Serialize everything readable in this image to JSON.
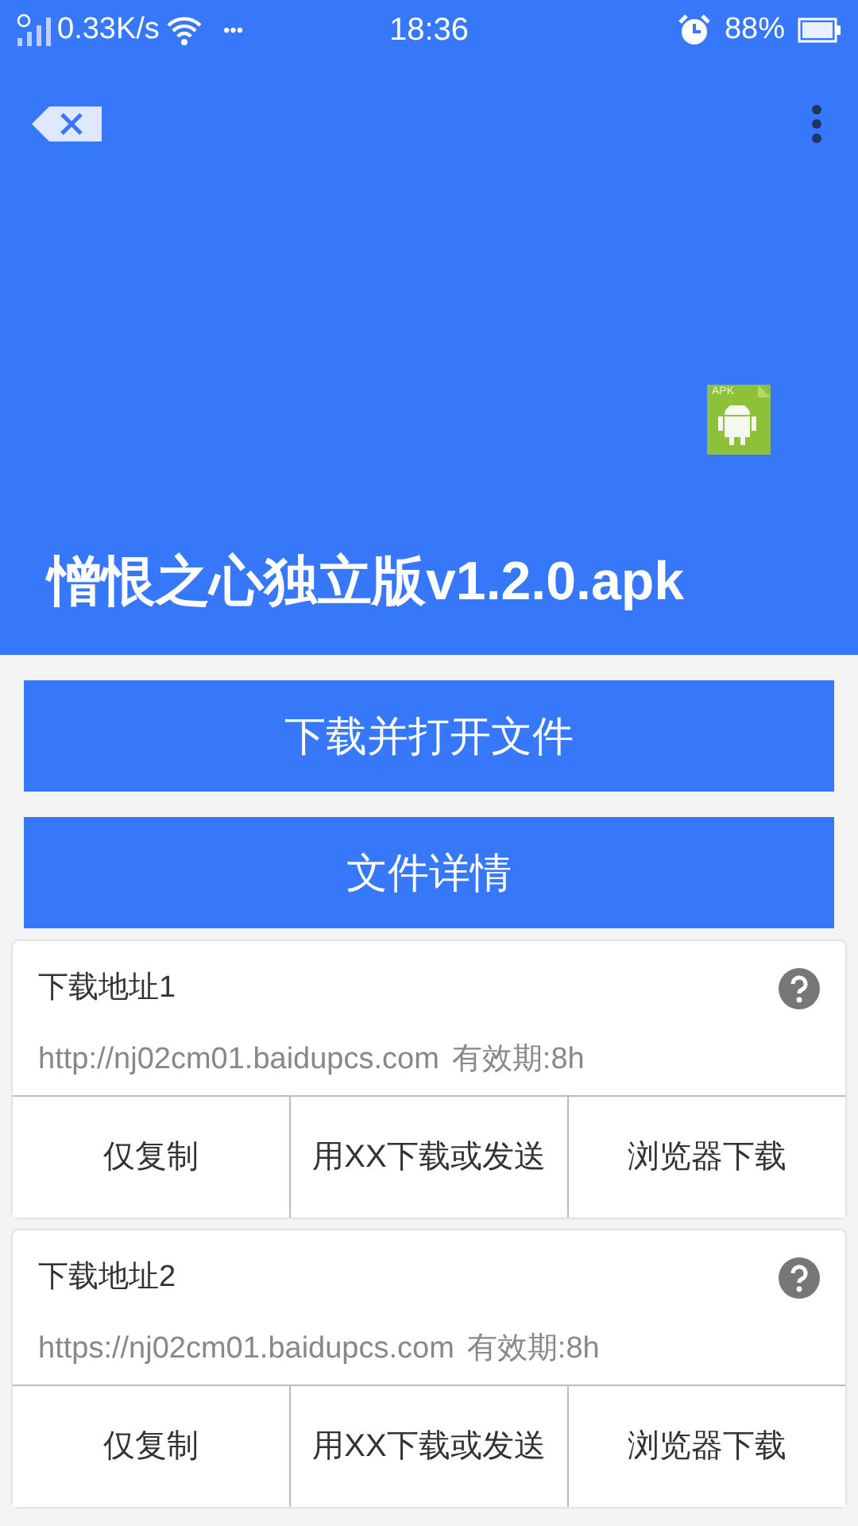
{
  "status_bar": {
    "speed": "0.33K/s",
    "more": "•••",
    "time": "18:36",
    "battery": "88%"
  },
  "file": {
    "icon_label": "APK",
    "name": "憎恨之心独立版v1.2.0.apk"
  },
  "actions": [
    "下载并打开文件",
    "文件详情"
  ],
  "links": [
    {
      "title": "下载地址1",
      "url": "http://nj02cm01.baidupcs.com",
      "expiry": "有效期:8h",
      "buttons": [
        "仅复制",
        "用XX下载或发送",
        "浏览器下载"
      ]
    },
    {
      "title": "下载地址2",
      "url": "https://nj02cm01.baidupcs.com",
      "expiry": "有效期:8h",
      "buttons": [
        "仅复制",
        "用XX下载或发送",
        "浏览器下载"
      ]
    }
  ]
}
